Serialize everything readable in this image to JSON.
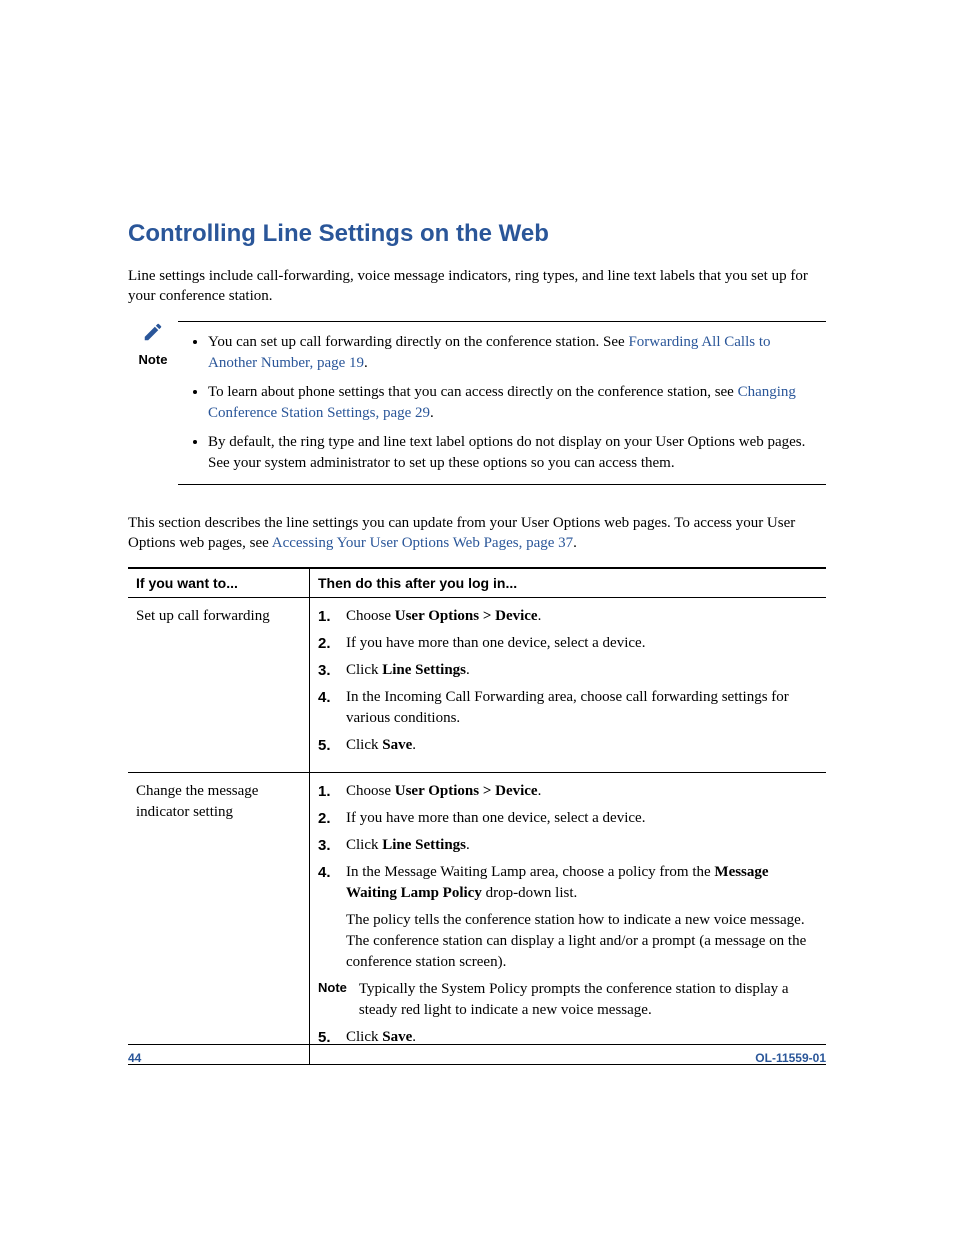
{
  "heading": "Controlling Line Settings on the Web",
  "intro": "Line settings include call-forwarding, voice message indicators, ring types, and line text labels that you set up for your conference station.",
  "note": {
    "label": "Note",
    "items": [
      {
        "pre": "You can set up call forwarding directly on the conference station. See ",
        "link": "Forwarding All Calls to Another Number, page 19",
        "post": "."
      },
      {
        "pre": "To learn about phone settings that you can access directly on the conference station, see ",
        "link": "Changing Conference Station Settings, page 29",
        "post": "."
      },
      {
        "pre": "By default, the ring type and line text label options do not display on your User Options web pages. See your system administrator to set up these options so you can access them.",
        "link": "",
        "post": ""
      }
    ]
  },
  "lead": {
    "pre": "This section describes the line settings you can update from your User Options web pages. To access your User Options web pages, see ",
    "link": "Accessing Your User Options Web Pages, page 37",
    "post": "."
  },
  "table": {
    "header_left": "If you want to...",
    "header_right": "Then do this after you log in...",
    "rows": [
      {
        "left": "Set up call forwarding",
        "steps": {
          "s1a": "Choose ",
          "s1b": "User Options > Device",
          "s1c": ".",
          "s2": "If you have more than one device, select a device.",
          "s3a": "Click ",
          "s3b": "Line Settings",
          "s3c": ".",
          "s4": "In the Incoming Call Forwarding area, choose call forwarding settings for various conditions.",
          "s5a": "Click ",
          "s5b": "Save",
          "s5c": "."
        }
      },
      {
        "left": "Change the message indicator setting",
        "steps": {
          "s1a": "Choose ",
          "s1b": "User Options > Device",
          "s1c": ".",
          "s2": "If you have more than one device, select a device.",
          "s3a": "Click ",
          "s3b": "Line Settings",
          "s3c": ".",
          "s4a": "In the Message Waiting Lamp area, choose a policy from the ",
          "s4b": "Message Waiting Lamp Policy",
          "s4c": " drop-down list.",
          "sub": "The policy tells the conference station how to indicate a new voice message. The conference station can display a light and/or a prompt (a message on the conference station screen).",
          "note_label": "Note",
          "note_text": "Typically the System Policy prompts the conference station to display a steady red light to indicate a new voice message.",
          "s5a": "Click ",
          "s5b": "Save",
          "s5c": "."
        }
      }
    ]
  },
  "footer": {
    "page": "44",
    "docid": "OL-11559-01"
  }
}
